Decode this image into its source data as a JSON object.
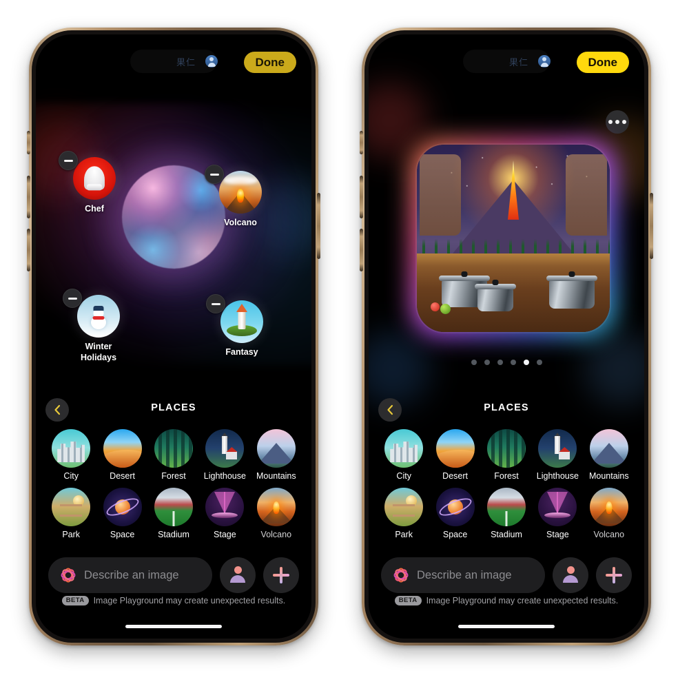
{
  "app": {
    "name": "Image Playground",
    "status_bar": {
      "island_text": "果仁",
      "avatar_icon": "person-circle-icon"
    }
  },
  "left_phone": {
    "done_label": "Done",
    "concepts": [
      {
        "label": "Chef",
        "art": "chef-concept-art",
        "remove_icon": "minus-badge-icon"
      },
      {
        "label": "Volcano",
        "art": "volcano-concept-art",
        "remove_icon": "minus-badge-icon"
      },
      {
        "label": "Winter Holidays",
        "art": "winter-holidays-concept-art",
        "remove_icon": "minus-badge-icon"
      },
      {
        "label": "Fantasy",
        "art": "fantasy-concept-art",
        "remove_icon": "minus-badge-icon"
      }
    ],
    "orb_icon": "generation-orb"
  },
  "right_phone": {
    "done_label": "Done",
    "more_icon": "ellipsis-icon",
    "result_image": "volcano-kitchen-generated-image",
    "pagination": {
      "total": 6,
      "active_index": 5
    }
  },
  "places_panel": {
    "back_icon": "chevron-left-icon",
    "title": "PLACES",
    "items": [
      {
        "label": "City",
        "art": "city-thumbnail"
      },
      {
        "label": "Desert",
        "art": "desert-thumbnail"
      },
      {
        "label": "Forest",
        "art": "forest-thumbnail"
      },
      {
        "label": "Lighthouse",
        "art": "lighthouse-thumbnail"
      },
      {
        "label": "Mountains",
        "art": "mountains-thumbnail"
      },
      {
        "label": "Park",
        "art": "park-thumbnail"
      },
      {
        "label": "Space",
        "art": "space-thumbnail"
      },
      {
        "label": "Stadium",
        "art": "stadium-thumbnail"
      },
      {
        "label": "Stage",
        "art": "stage-thumbnail"
      },
      {
        "label": "Volcano",
        "art": "volcano-thumbnail"
      }
    ]
  },
  "bottom_bar": {
    "search_placeholder": "Describe an image",
    "search_value": "",
    "ai_icon": "apple-intelligence-icon",
    "person_button_icon": "person-icon",
    "add_button_icon": "plus-icon",
    "beta_badge": "BETA",
    "disclaimer": "Image Playground may create unexpected results."
  },
  "colors": {
    "done_dim": "#cbaa1b",
    "done_bright": "#ffd90d",
    "accent_pink": "#f59a8e",
    "screen_bg": "#000000",
    "panel_chip": "#2c2c2e"
  }
}
